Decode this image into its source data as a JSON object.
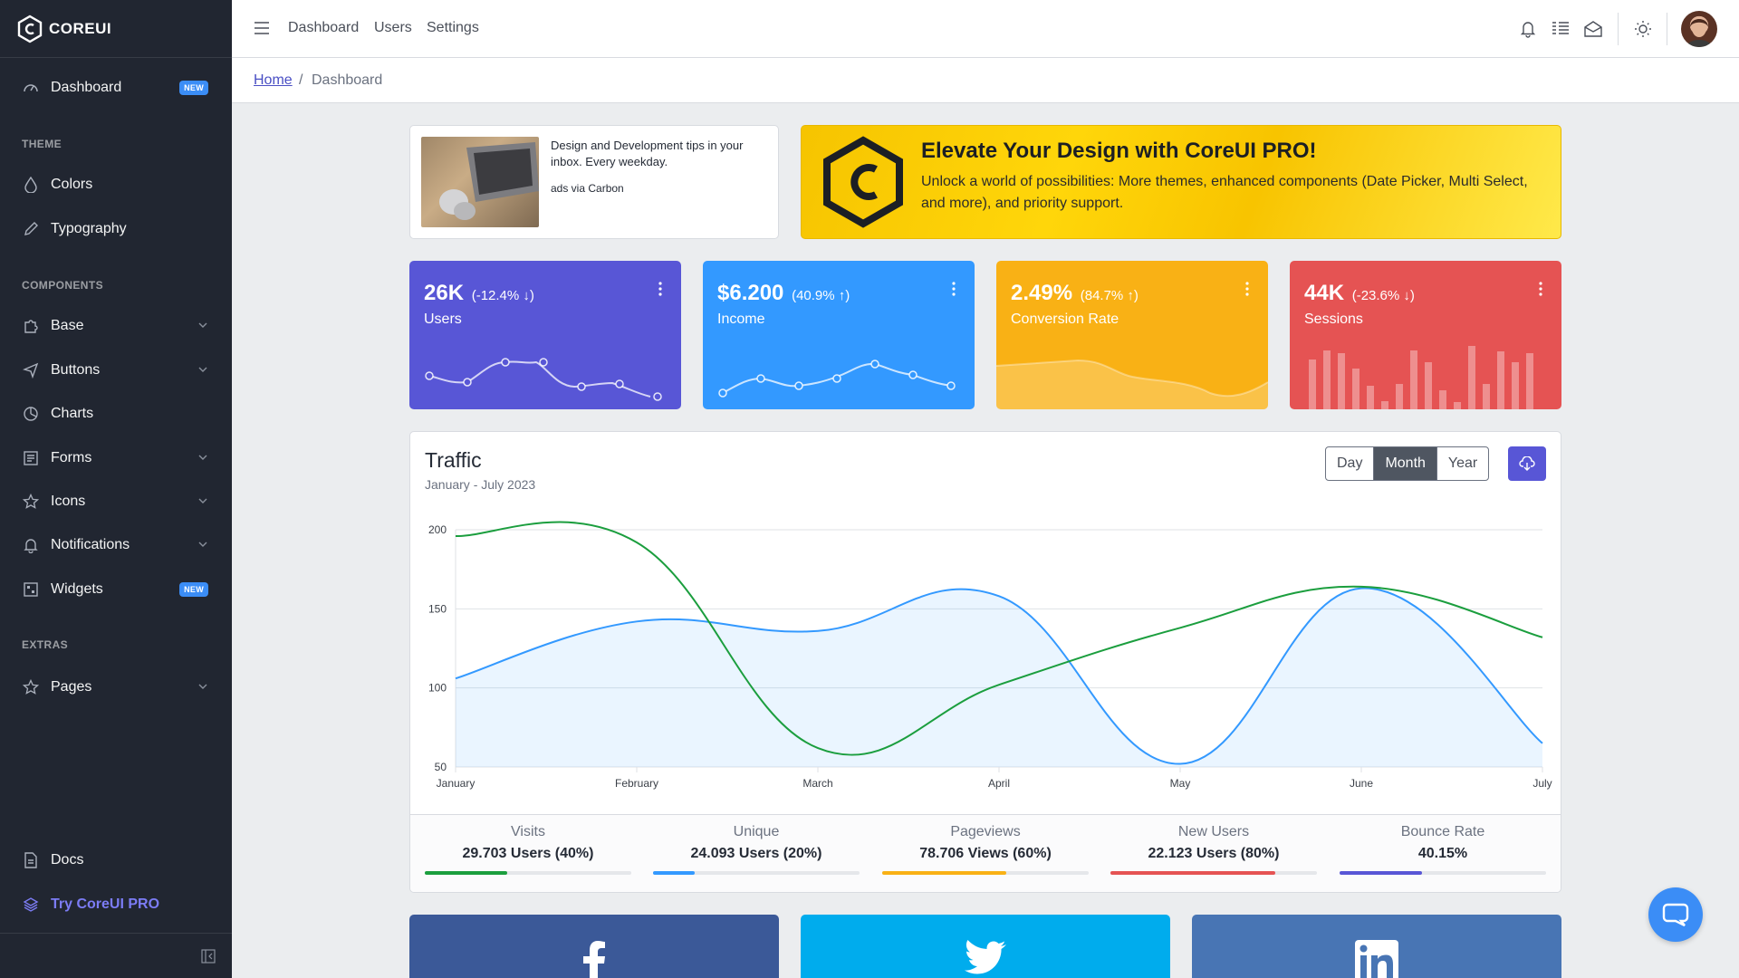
{
  "brand": {
    "name": "COREUI"
  },
  "sidebar": {
    "dashboard": {
      "label": "Dashboard",
      "badge": "NEW"
    },
    "theme_title": "THEME",
    "colors": "Colors",
    "typography": "Typography",
    "components_title": "COMPONENTS",
    "base": "Base",
    "buttons": "Buttons",
    "charts": "Charts",
    "forms": "Forms",
    "icons": "Icons",
    "notifications": "Notifications",
    "widgets": {
      "label": "Widgets",
      "badge": "NEW"
    },
    "extras_title": "EXTRAS",
    "pages": "Pages",
    "docs": "Docs",
    "try_pro": "Try CoreUI PRO"
  },
  "header": {
    "nav": [
      "Dashboard",
      "Users",
      "Settings"
    ]
  },
  "breadcrumb": {
    "home": "Home",
    "separator": "/",
    "current": "Dashboard"
  },
  "carbon_ad": {
    "text": "Design and Development tips in your inbox. Every weekday.",
    "via": "ads via Carbon"
  },
  "promo": {
    "title": "Elevate Your Design with CoreUI PRO!",
    "body": "Unlock a world of possibilities: More themes, enhanced components (Date Picker, Multi Select, and more), and priority support."
  },
  "widgets": [
    {
      "value": "26K",
      "change": "(-12.4% ↓)",
      "label": "Users",
      "color": "#5856d6"
    },
    {
      "value": "$6.200",
      "change": "(40.9% ↑)",
      "label": "Income",
      "color": "#3399ff"
    },
    {
      "value": "2.49%",
      "change": "(84.7% ↑)",
      "label": "Conversion Rate",
      "color": "#f9b115"
    },
    {
      "value": "44K",
      "change": "(-23.6% ↓)",
      "label": "Sessions",
      "color": "#e55353"
    }
  ],
  "traffic": {
    "title": "Traffic",
    "subtitle": "January - July 2023",
    "periods": [
      "Day",
      "Month",
      "Year"
    ],
    "active_period": "Month"
  },
  "chart_data": {
    "type": "line",
    "categories": [
      "January",
      "February",
      "March",
      "April",
      "May",
      "June",
      "July"
    ],
    "ylim": [
      50,
      200
    ],
    "yticks": [
      50,
      100,
      150,
      200
    ],
    "grid": true,
    "series": [
      {
        "values": [
          106,
          142,
          136,
          158,
          52,
          163,
          65
        ],
        "color": "#3399ff",
        "fill": true
      },
      {
        "values": [
          196,
          192,
          62,
          102,
          138,
          164,
          132
        ],
        "color": "#1b9e3e",
        "fill": false
      }
    ]
  },
  "stats": [
    {
      "label": "Visits",
      "value": "29.703 Users (40%)",
      "percent": 40,
      "color": "#1b9e3e"
    },
    {
      "label": "Unique",
      "value": "24.093 Users (20%)",
      "percent": 20,
      "color": "#3399ff"
    },
    {
      "label": "Pageviews",
      "value": "78.706 Views (60%)",
      "percent": 60,
      "color": "#f9b115"
    },
    {
      "label": "New Users",
      "value": "22.123 Users (80%)",
      "percent": 80,
      "color": "#e55353"
    },
    {
      "label": "Bounce Rate",
      "value": "40.15%",
      "percent": 40,
      "color": "#5856d6"
    }
  ],
  "social": [
    {
      "name": "facebook-icon",
      "color": "#3b5998"
    },
    {
      "name": "twitter-icon",
      "color": "#00aced"
    },
    {
      "name": "linkedin-icon",
      "color": "#4875b4"
    }
  ]
}
